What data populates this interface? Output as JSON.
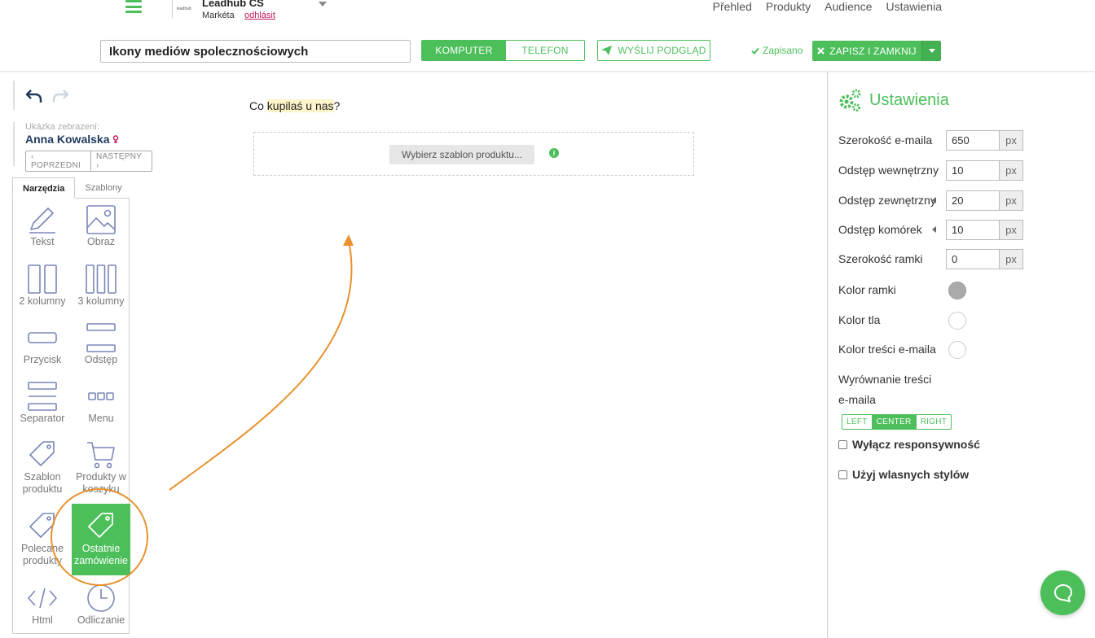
{
  "header": {
    "brand_logo_text": "leadhub",
    "account_name": "Leadhub CS",
    "account_user": "Markéta",
    "logout_label": "odhlásit",
    "nav": [
      "Přehled",
      "Produkty",
      "Audience",
      "Ustawienia"
    ]
  },
  "toolbar": {
    "title_value": "Ikony mediów spolecznościowych",
    "device_desktop": "KOMPUTER",
    "device_phone": "TELEFON",
    "send_preview": "WYŚLIJ PODGLĄD",
    "saved_status": "Zapisano",
    "save_close": "ZAPISZ I ZAMKNIJ"
  },
  "sample": {
    "label": "Ukázka zebrazení:",
    "name": "Anna Kowalska",
    "prev": "POPRZEDNI",
    "next": "NASTĘPNY"
  },
  "tabs": [
    "Narzędzia",
    "Szablony"
  ],
  "tools": [
    {
      "label": "Tekst",
      "icon": "pencil-icon"
    },
    {
      "label": "Obraz",
      "icon": "image-icon"
    },
    {
      "label": "2 kolumny",
      "icon": "two-columns-icon"
    },
    {
      "label": "3 kolumny",
      "icon": "three-columns-icon"
    },
    {
      "label": "Przycisk",
      "icon": "button-icon"
    },
    {
      "label": "Odstęp",
      "icon": "spacer-icon"
    },
    {
      "label": "Separator",
      "icon": "separator-icon"
    },
    {
      "label": "Menu",
      "icon": "menu-icon"
    },
    {
      "label": "Szablon produktu",
      "icon": "tag-icon"
    },
    {
      "label": "Produkty w koszyku",
      "icon": "cart-icon"
    },
    {
      "label": "Polecane produkty",
      "icon": "tag-icon"
    },
    {
      "label": "Ostatnie zamówienie",
      "icon": "tag-icon"
    },
    {
      "label": "Html",
      "icon": "code-icon"
    },
    {
      "label": "Odliczanie",
      "icon": "clock-icon"
    }
  ],
  "canvas": {
    "text_before": "Co ",
    "text_highlight": "kupilaś u nas",
    "text_after": "?",
    "product_button": "Wybierz szablon produktu..."
  },
  "settings": {
    "title": "Ustawienia",
    "unit": "px",
    "email_width_label": "Szerokość e-maila",
    "email_width": "650",
    "inner_padding_label": "Odstęp wewnętrzny",
    "inner_padding": "10",
    "outer_padding_label": "Odstęp zewnętrzny",
    "outer_padding": "20",
    "cell_spacing_label": "Odstęp komórek",
    "cell_spacing": "10",
    "border_width_label": "Szerokość ramki",
    "border_width": "0",
    "border_color_label": "Kolor ramki",
    "bg_color_label": "Kolor tla",
    "content_color_label": "Kolor treści e-maila",
    "align_label_1": "Wyrównanie treści",
    "align_label_2": "e-maila",
    "align_left": "LEFT",
    "align_center": "CENTER",
    "align_right": "RIGHT",
    "disable_responsive": "Wyłącz responsywność",
    "custom_styles": "Użyj wlasnych stylów"
  },
  "colors": {
    "accent": "#4cbf5b",
    "annotation": "#e8912d",
    "sample_name": "#1e3a5f",
    "logout": "#c2185b"
  }
}
